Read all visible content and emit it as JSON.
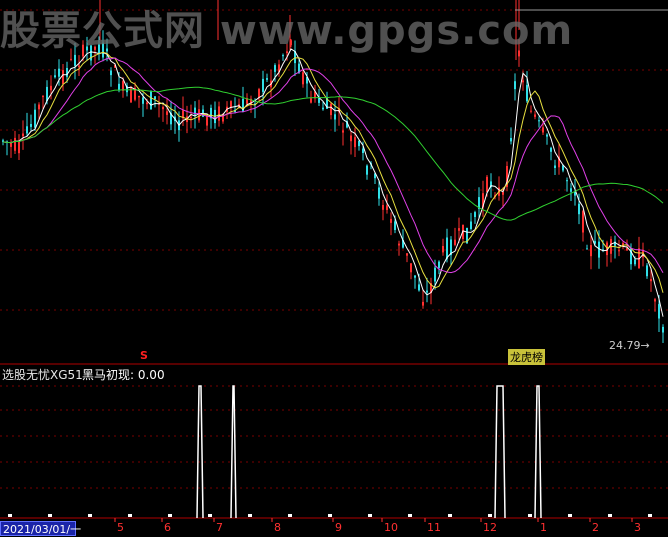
{
  "watermark": {
    "text": "股票公式网 www.gpgs.com"
  },
  "main_chart": {
    "last_price_label": "24.79",
    "signal_marker": "S",
    "ranking_badge": "龙虎榜"
  },
  "indicator": {
    "title": "选股无忧XG51",
    "series_label": "黑马初现: 0.00"
  },
  "time_axis": {
    "start_date": "2021/03/01/一",
    "month_ticks": [
      "5",
      "6",
      "7",
      "8",
      "9",
      "10",
      "11",
      "12",
      "1",
      "2",
      "3"
    ]
  },
  "colors": {
    "background": "#000000",
    "grid": "#7a0000",
    "candle_up": "#ff3030",
    "candle_down": "#31e0e8",
    "ma_short": "#ffffff",
    "ma_mid": "#e8e040",
    "ma_long": "#e040e8",
    "ma_longest": "#30d030",
    "signal": "#ffffff"
  }
}
